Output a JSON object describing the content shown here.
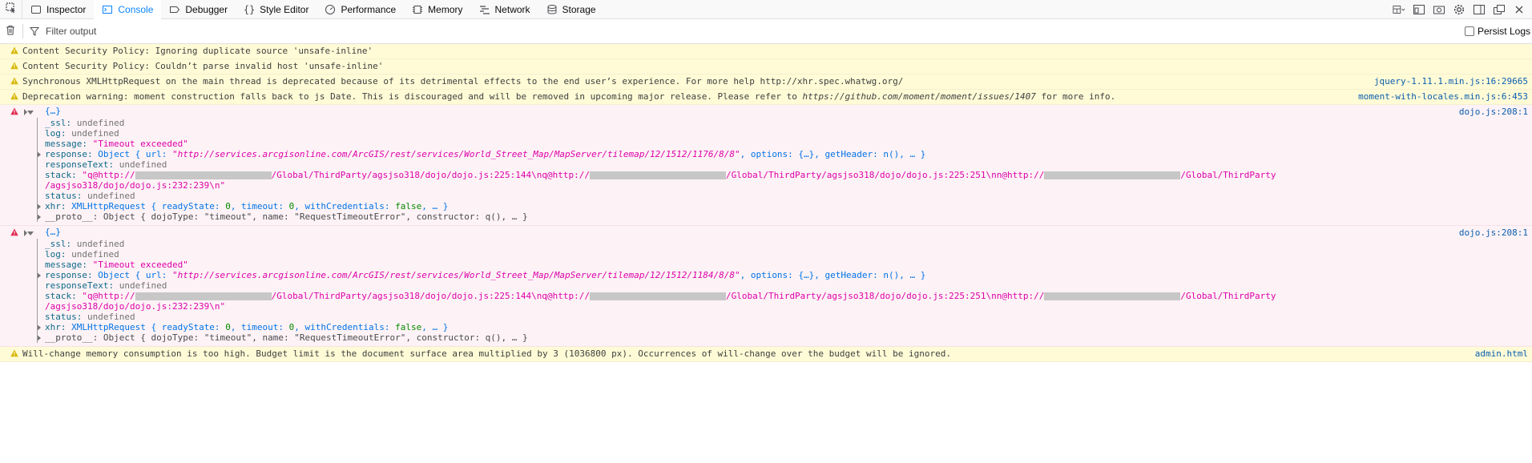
{
  "toolbar": {
    "tabs": [
      {
        "label": "Inspector",
        "icon": "inspector-icon",
        "selected": false
      },
      {
        "label": "Console",
        "icon": "console-icon",
        "selected": true
      },
      {
        "label": "Debugger",
        "icon": "debugger-icon",
        "selected": false
      },
      {
        "label": "Style Editor",
        "icon": "style-editor-icon",
        "selected": false
      },
      {
        "label": "Performance",
        "icon": "performance-icon",
        "selected": false
      },
      {
        "label": "Memory",
        "icon": "memory-icon",
        "selected": false
      },
      {
        "label": "Network",
        "icon": "network-icon",
        "selected": false
      },
      {
        "label": "Storage",
        "icon": "storage-icon",
        "selected": false
      }
    ],
    "accent": "#0a84ff"
  },
  "filterbar": {
    "placeholder": "Filter output",
    "persist_label": "Persist Logs"
  },
  "messages": {
    "w1": {
      "text": "Content Security Policy: Ignoring duplicate source 'unsafe-inline'"
    },
    "w2": {
      "text": "Content Security Policy: Couldn’t parse invalid host 'unsafe-inline'"
    },
    "w3": {
      "text": "Synchronous XMLHttpRequest on the main thread is deprecated because of its detrimental effects to the end user’s experience. For more help http://xhr.spec.whatwg.org/",
      "source": "jquery-1.11.1.min.js:16:29665"
    },
    "w4": {
      "text_a": "Deprecation warning: moment construction falls back to js Date. This is discouraged and will be removed in upcoming major release. Please refer to ",
      "link": "https://github.com/moment/moment/issues/1407",
      "text_b": " for more info.",
      "source": "moment-with-locales.min.js:6:453"
    },
    "w5": {
      "text": "Will-change memory consumption is too high. Budget limit is the document surface area multiplied by 3 (1036800 px). Occurrences of will-change over the budget will be ignored.",
      "source": "admin.html"
    }
  },
  "errors": [
    {
      "head": "{…}",
      "source": "dojo.js:208:1",
      "ssl": "_ssl:",
      "ssl_val": "undefined",
      "log": "log:",
      "log_val": "undefined",
      "message": "message:",
      "message_val": "\"Timeout exceeded\"",
      "response": "response:",
      "response_obj": "Object { url: ",
      "response_url": "\"http://services.arcgisonline.com/ArcGIS/rest/services/World_Street_Map/MapServer/tilemap/12/1512/1176/8/8\"",
      "response_rest": ", options: {…}, getHeader: n(), … }",
      "responseText": "responseText:",
      "responseText_val": "undefined",
      "stack": "stack:",
      "stack_p1": "\"q@http://",
      "stack_p2": "/Global/ThirdParty/agsjso318/dojo/dojo.js:225:144\\nq@http://",
      "stack_p3": "/Global/ThirdParty/agsjso318/dojo/dojo.js:225:251\\nn@http://",
      "stack_p4": "/Global/ThirdParty",
      "stack_p5": "/agsjso318/dojo/dojo.js:232:239\\n\"",
      "status": "status:",
      "status_val": "undefined",
      "xhr": "xhr:",
      "xhr_obj": "XMLHttpRequest { readyState: ",
      "xhr_rs": "0",
      "xhr_mid": ", timeout: ",
      "xhr_to": "0",
      "xhr_mid2": ", withCredentials: ",
      "xhr_wc": "false",
      "xhr_end": ", … }",
      "proto": "__proto__:",
      "proto_val": "Object { dojoType: \"timeout\", name: \"RequestTimeoutError\", constructor: q(), … }"
    },
    {
      "head": "{…}",
      "source": "dojo.js:208:1",
      "ssl": "_ssl:",
      "ssl_val": "undefined",
      "log": "log:",
      "log_val": "undefined",
      "message": "message:",
      "message_val": "\"Timeout exceeded\"",
      "response": "response:",
      "response_obj": "Object { url: ",
      "response_url": "\"http://services.arcgisonline.com/ArcGIS/rest/services/World_Street_Map/MapServer/tilemap/12/1512/1184/8/8\"",
      "response_rest": ", options: {…}, getHeader: n(), … }",
      "responseText": "responseText:",
      "responseText_val": "undefined",
      "stack": "stack:",
      "stack_p1": "\"q@http://",
      "stack_p2": "/Global/ThirdParty/agsjso318/dojo/dojo.js:225:144\\nq@http://",
      "stack_p3": "/Global/ThirdParty/agsjso318/dojo/dojo.js:225:251\\nn@http://",
      "stack_p4": "/Global/ThirdParty",
      "stack_p5": "/agsjso318/dojo/dojo.js:232:239\\n\"",
      "status": "status:",
      "status_val": "undefined",
      "xhr": "xhr:",
      "xhr_obj": "XMLHttpRequest { readyState: ",
      "xhr_rs": "0",
      "xhr_mid": ", timeout: ",
      "xhr_to": "0",
      "xhr_mid2": ", withCredentials: ",
      "xhr_wc": "false",
      "xhr_end": ", … }",
      "proto": "__proto__:",
      "proto_val": "Object { dojoType: \"timeout\", name: \"RequestTimeoutError\", constructor: q(), … }"
    }
  ]
}
